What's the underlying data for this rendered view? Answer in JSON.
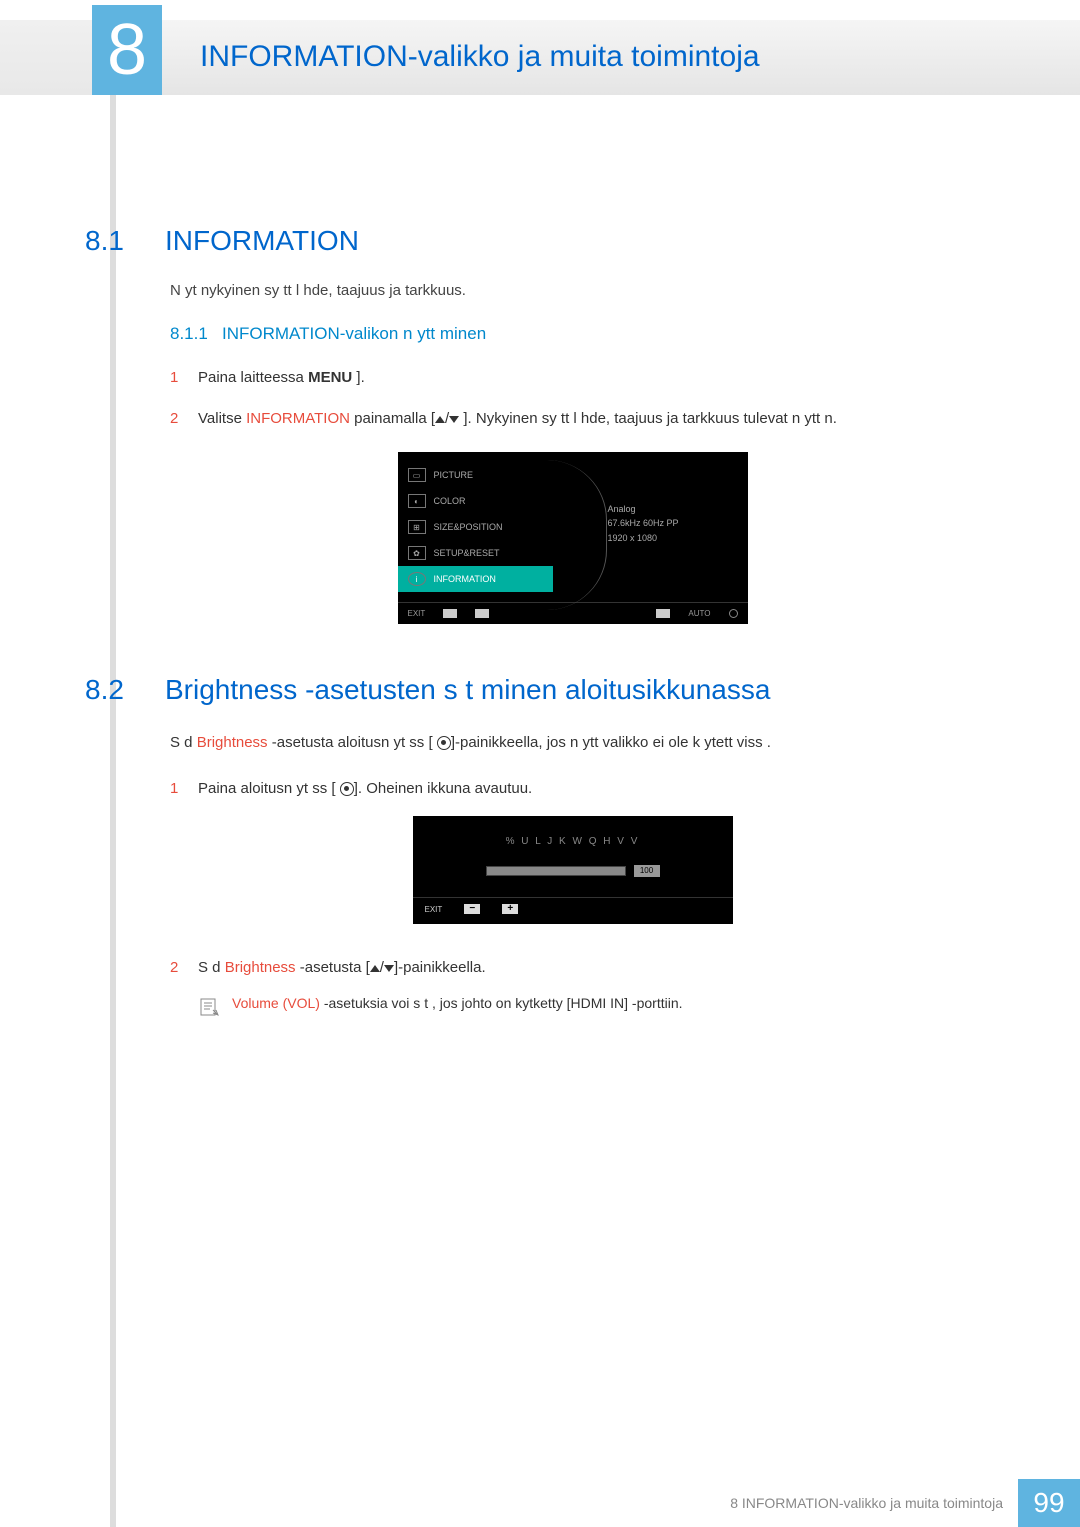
{
  "chapter": {
    "number": "8",
    "title": "INFORMATION-valikko ja muita toimintoja"
  },
  "section1": {
    "number": "8.1",
    "title": "INFORMATION",
    "intro": "N yt  nykyinen sy tt l hde, taajuus ja tarkkuus.",
    "subsection": {
      "number": "8.1.1",
      "title": "INFORMATION-valikon n ytt minen"
    },
    "step1": {
      "n": "1",
      "pre": "Paina laitteessa ",
      "menu": "MENU",
      "post": " ]."
    },
    "step2": {
      "n": "2",
      "pre": "Valitse ",
      "info": "INFORMATION",
      "mid": " painamalla ",
      "post": "]. Nykyinen sy tt l hde, taajuus ja tarkkuus tulevat n ytt  n."
    }
  },
  "osd1": {
    "menu": [
      "PICTURE",
      "COLOR",
      "SIZE&POSITION",
      "SETUP&RESET",
      "INFORMATION"
    ],
    "info": {
      "l1": "Analog",
      "l2": "67.6kHz 60Hz PP",
      "l3": "1920 x 1080"
    },
    "footer": {
      "exit": "EXIT",
      "auto": "AUTO"
    }
  },
  "section2": {
    "number": "8.2",
    "title": "Brightness -asetusten s     t minen aloitusikkunassa",
    "para_pre": "S  d  ",
    "para_red": "Brightness ",
    "para_mid": "-asetusta aloitusn yt ss  [ ",
    "para_post": "-painikkeella, jos n ytt valikko ei ole k ytett viss .",
    "step1": {
      "n": "1",
      "pre": "Paina aloitusn yt ss  [ ",
      "post": ". Oheinen ikkuna avautuu."
    },
    "step2": {
      "n": "2",
      "pre": "S  d  ",
      "red": "Brightness",
      "post": "   -asetusta [",
      "end": "]-painikkeella."
    },
    "note_pre": "Volume ",
    "note_vol": "(VOL)",
    "note_post": " -asetuksia voi s  t  , jos johto on kytketty [HDMI IN] -porttiin."
  },
  "osd2": {
    "title": "% U L J K W Q H V V",
    "value": "100",
    "exit": "EXIT"
  },
  "footer": {
    "text": "8 INFORMATION-valikko ja muita toimintoja",
    "page": "99"
  }
}
